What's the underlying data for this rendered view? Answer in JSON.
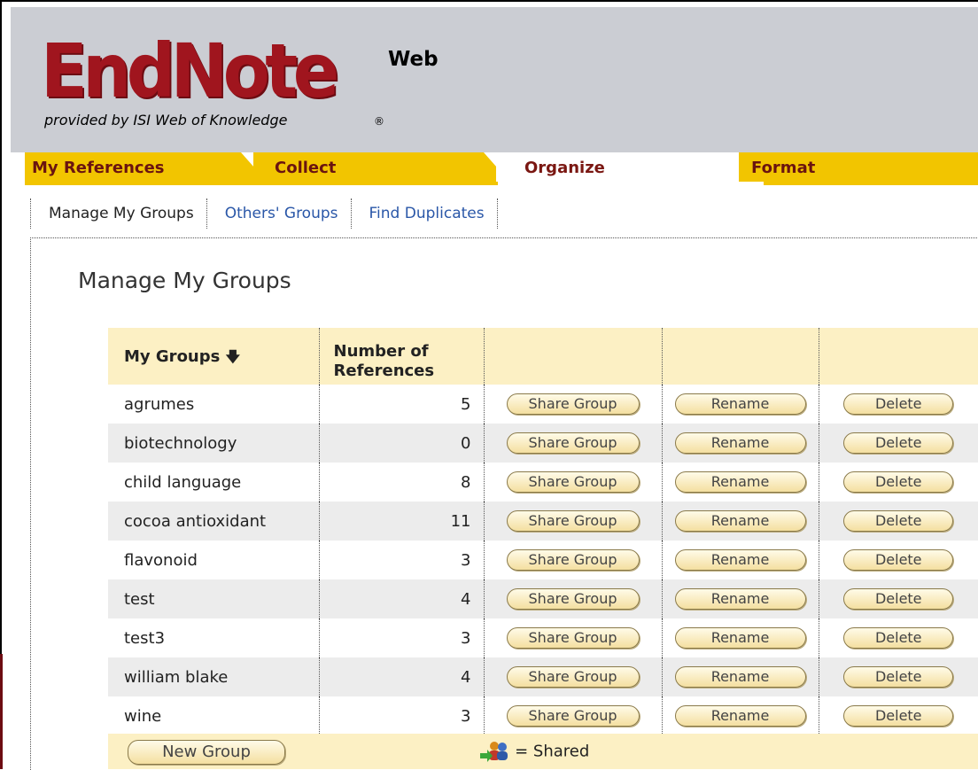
{
  "branding": {
    "logo_text": "EndNote",
    "logo_suffix": "Web",
    "tagline": "provided by ISI Web of Knowledge",
    "registered": "®",
    "brand_color": "#a0151e",
    "tab_color": "#f2c500"
  },
  "tabs": [
    {
      "label": "My References",
      "active": false
    },
    {
      "label": "Collect",
      "active": false
    },
    {
      "label": "Organize",
      "active": true
    },
    {
      "label": "Format",
      "active": false
    }
  ],
  "subnav": [
    {
      "label": "Manage My Groups",
      "current": true
    },
    {
      "label": "Others' Groups",
      "current": false
    },
    {
      "label": "Find Duplicates",
      "current": false
    }
  ],
  "page_title": "Manage My Groups",
  "table": {
    "header_groups": "My Groups",
    "sort_icon": "down-arrow-icon",
    "header_refs_line1": "Number of",
    "header_refs_line2": "References",
    "rows": [
      {
        "name": "agrumes",
        "count": "5"
      },
      {
        "name": "biotechnology",
        "count": "0"
      },
      {
        "name": "child language",
        "count": "8"
      },
      {
        "name": "cocoa antioxidant",
        "count": "11"
      },
      {
        "name": "flavonoid",
        "count": "3"
      },
      {
        "name": "test",
        "count": "4"
      },
      {
        "name": "test3",
        "count": "3"
      },
      {
        "name": "william blake",
        "count": "4"
      },
      {
        "name": "wine",
        "count": "3"
      }
    ],
    "share_label": "Share Group",
    "rename_label": "Rename",
    "delete_label": "Delete"
  },
  "footer": {
    "new_group_label": "New Group",
    "shared_icon": "shared-users-icon",
    "shared_legend": "= Shared"
  }
}
